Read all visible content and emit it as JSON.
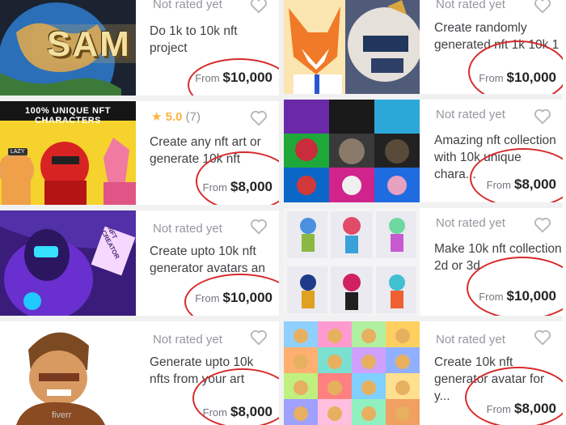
{
  "left_cards": [
    {
      "rating_text": "Not rated yet",
      "title": "Do 1k to 10k nft project",
      "price_prefix": "From",
      "price": "$10,000",
      "thumb_text": "SAM"
    },
    {
      "rating_score": "5.0",
      "rating_count": "(7)",
      "title": "Create any nft art or generate 10k nft",
      "price_prefix": "From",
      "price": "$8,000",
      "thumb_text": "100% UNIQUE NFT CHARACTERS",
      "thumb_badge": "LAZY"
    },
    {
      "rating_text": "Not rated yet",
      "title": "Create upto 10k nft generator avatars an",
      "price_prefix": "From",
      "price": "$10,000",
      "thumb_text": "NFT CREATOR"
    },
    {
      "rating_text": "Not rated yet",
      "title": "Generate upto 10k nfts from your art",
      "price_prefix": "From",
      "price": "$8,000",
      "thumb_text": "fiverr"
    }
  ],
  "right_cards": [
    {
      "rating_text": "Not rated yet",
      "title": "Create randomly generated nft 1k 10k 1",
      "price_prefix": "From",
      "price": "$10,000"
    },
    {
      "rating_text": "Not rated yet",
      "title": "Amazing nft collection with 10k unique chara...",
      "price_prefix": "From",
      "price": "$8,000"
    },
    {
      "rating_text": "Not rated yet",
      "title": "Make 10k nft collection 2d or 3d",
      "price_prefix": "From",
      "price": "$10,000"
    },
    {
      "rating_text": "Not rated yet",
      "title": "Create 10k nft generator avatar for y...",
      "price_prefix": "From",
      "price": "$8,000"
    }
  ],
  "colors": {
    "annotation_red": "#d62b2b",
    "star": "#ffb33e",
    "muted": "#95979d"
  },
  "icons": {
    "favorite": "heart-outline-icon",
    "rating": "star-icon"
  }
}
